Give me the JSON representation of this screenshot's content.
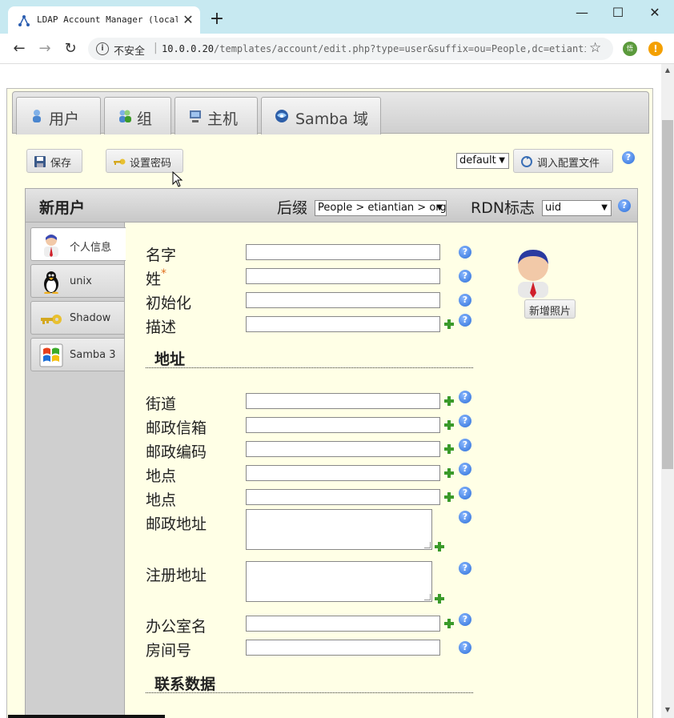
{
  "browser": {
    "tab_title": "LDAP Account Manager (localhost)",
    "insecure_label": "不安全",
    "url_host": "10.0.0.20",
    "url_path": "/templates/account/edit.php?type=user&suffix=ou=People,dc=etiantian,dc=org",
    "ext_badge_text": "悟"
  },
  "main_tabs": [
    {
      "label": "用户",
      "icon": "user-icon"
    },
    {
      "label": "组",
      "icon": "group-icon"
    },
    {
      "label": "主机",
      "icon": "computer-icon"
    },
    {
      "label": "Samba 域",
      "icon": "samba-globe-icon"
    }
  ],
  "toolbar": {
    "save_label": "保存",
    "set_password_label": "设置密码",
    "profile_select_value": "default",
    "load_profile_label": "调入配置文件"
  },
  "panel": {
    "title": "新用户",
    "suffix_label": "后缀",
    "suffix_value": "People > etiantian > org",
    "rdn_label": "RDN标志",
    "rdn_value": "uid"
  },
  "side_tabs": [
    {
      "label": "个人信息",
      "icon": "person-icon"
    },
    {
      "label": "unix",
      "icon": "tux-penguin-icon"
    },
    {
      "label": "Shadow",
      "icon": "key-icon"
    },
    {
      "label": "Samba 3",
      "icon": "windows-flag-icon"
    }
  ],
  "personal": {
    "first_name_label": "名字",
    "last_name_label": "姓",
    "required_mark": "*",
    "initials_label": "初始化",
    "description_label": "描述"
  },
  "address_section": {
    "title": "地址",
    "street_label": "街道",
    "po_box_label": "邮政信箱",
    "postal_code_label": "邮政编码",
    "location_label": "地点",
    "state_label": "地点",
    "postal_address_label": "邮政地址",
    "registered_address_label": "注册地址",
    "office_name_label": "办公室名",
    "room_number_label": "房间号"
  },
  "contact_section": {
    "title": "联系数据"
  },
  "photo": {
    "add_photo_label": "新增照片"
  },
  "help_glyph": "?"
}
